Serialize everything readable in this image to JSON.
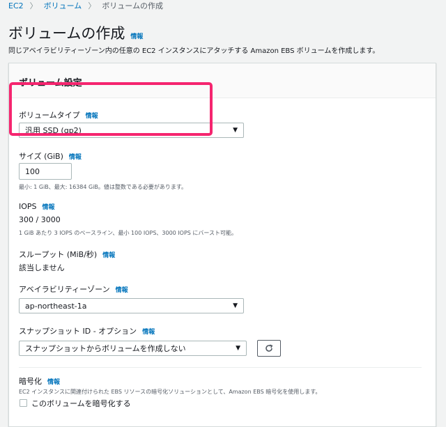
{
  "breadcrumb": {
    "items": [
      "EC2",
      "ボリューム",
      "ボリュームの作成"
    ],
    "separator": "〉"
  },
  "page": {
    "title": "ボリュームの作成",
    "info": "情報",
    "description": "同じアベイラビリティーゾーン内の任意の EC2 インスタンスにアタッチする Amazon EBS ボリュームを作成します。"
  },
  "panel": {
    "header": "ボリューム設定",
    "volume_type": {
      "label": "ボリュームタイプ",
      "info": "情報",
      "value": "汎用 SSD (gp2)"
    },
    "size": {
      "label": "サイズ (GiB)",
      "info": "情報",
      "value": "100",
      "hint": "最小: 1 GiB、最大: 16384 GiB。値は整数である必要があります。"
    },
    "iops": {
      "label": "IOPS",
      "info": "情報",
      "value": "300 / 3000",
      "hint": "1 GiB あたり 3 IOPS のベースライン、最小 100 IOPS、3000 IOPS にバースト可能。"
    },
    "throughput": {
      "label": "スループット (MiB/秒)",
      "info": "情報",
      "value": "該当しません"
    },
    "availability_zone": {
      "label": "アベイラビリティーゾーン",
      "info": "情報",
      "value": "ap-northeast-1a"
    },
    "snapshot": {
      "label": "スナップショット ID - オプション",
      "info": "情報",
      "value": "スナップショットからボリュームを作成しない"
    },
    "encryption": {
      "label": "暗号化",
      "info": "情報",
      "description": "EC2 インスタンスに関連付けられた EBS リソースの暗号化ソリューションとして、Amazon EBS 暗号化を使用します。",
      "checkbox_label": "このボリュームを暗号化する",
      "checked": false
    }
  },
  "colors": {
    "link": "#0073bb",
    "highlight": "#f5256f"
  }
}
